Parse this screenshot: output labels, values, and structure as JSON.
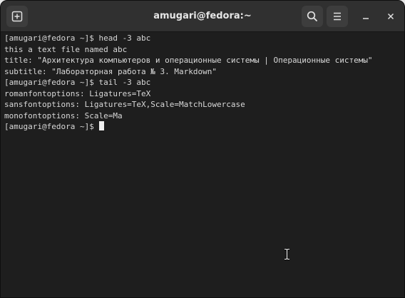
{
  "window": {
    "title": "amugari@fedora:~"
  },
  "titlebar": {
    "icons": [
      "new-tab-icon",
      "search-icon",
      "hamburger-menu-icon",
      "minimize-icon",
      "close-icon"
    ]
  },
  "terminal": {
    "lines": [
      "[amugari@fedora ~]$ head -3 abc",
      "this a text file named abc",
      "title: \"Архитектура компьютеров и операционные системы | Операционные системы\"",
      "subtitle: \"Лабораторная работа № 3. Markdown\"",
      "[amugari@fedora ~]$ tail -3 abc",
      "romanfontoptions: Ligatures=TeX",
      "sansfontoptions: Ligatures=TeX,Scale=MatchLowercase",
      "monofontoptions: Scale=Ma"
    ],
    "prompt": "[amugari@fedora ~]$ "
  },
  "colors": {
    "background": "#1e1e1e",
    "titlebar": "#303030",
    "text": "#d8d8d8",
    "cursor": "#f0f0f0"
  }
}
